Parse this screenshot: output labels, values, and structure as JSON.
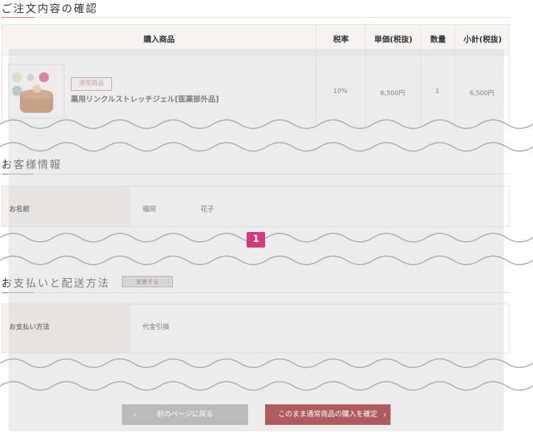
{
  "order_section": {
    "title": "ご注文内容の確認",
    "headers": {
      "product": "購入商品",
      "tax_rate": "税率",
      "unit_price": "単価(税抜)",
      "quantity": "数量",
      "subtotal": "小計(税抜)"
    },
    "item": {
      "tag": "通常商品",
      "name": "薬用リンクルストレッチジェル[医薬部外品]",
      "tax_rate": "10%",
      "unit_price": "6,500円",
      "quantity": "1",
      "subtotal": "6,500円"
    }
  },
  "customer_section": {
    "title": "お客様情報",
    "name_label": "お名前",
    "last_name": "福岡",
    "first_name": "花子"
  },
  "payment_section": {
    "title": "お支払いと配送方法",
    "change_label": "変更する",
    "method_label": "お支払い方法",
    "method_value": "代金引換"
  },
  "marker_label": "1",
  "buttons": {
    "back_label": "前のページに戻る",
    "confirm_label": "このまま通常商品の購入を確定"
  },
  "colors": {
    "accent": "#c5797a",
    "confirm_button": "#b25b5d",
    "back_button": "#bdbbb9",
    "marker": "#d23a7b",
    "header_bg": "#f6f4f2"
  },
  "icons": {
    "back": "chevron-left-icon",
    "confirm": "chevron-right-icon",
    "change": "chevron-right-icon"
  }
}
